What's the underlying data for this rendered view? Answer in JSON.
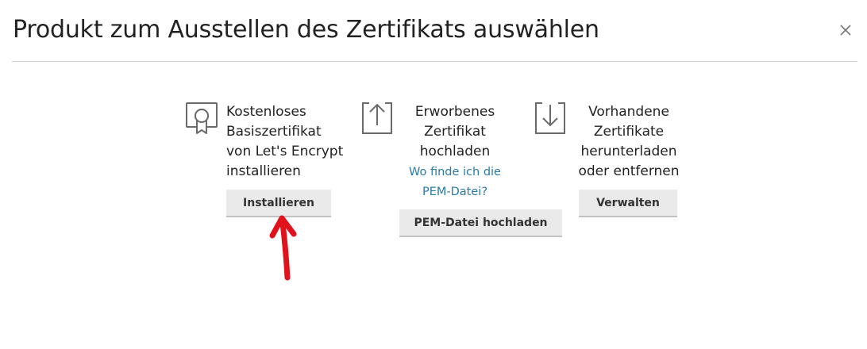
{
  "dialog": {
    "title": "Produkt zum Ausstellen des Zertifikats auswählen",
    "close_icon": "close-icon"
  },
  "options": [
    {
      "icon": "certificate-badge-icon",
      "text": "Kostenloses Basiszertifikat von Let's Encrypt installieren",
      "text_lines": [
        "Kostenloses",
        "Basiszertifikat",
        "von Let's Encrypt",
        "installieren"
      ],
      "button_label": "Installieren"
    },
    {
      "icon": "upload-icon",
      "text_lines": [
        "Erworbenes",
        "Zertifikat",
        "hochladen"
      ],
      "link_lines": [
        "Wo finde ich die",
        "PEM-Datei?"
      ],
      "button_label": "PEM-Datei hochladen"
    },
    {
      "icon": "download-icon",
      "text_lines": [
        "Vorhandene",
        "Zertifikate",
        "herunterladen",
        "oder entfernen"
      ],
      "button_label": "Verwalten"
    }
  ],
  "annotation": {
    "icon": "red-arrow-pointing-up",
    "color": "#e0121b"
  },
  "colors": {
    "link": "#2a7aa8",
    "button_bg": "#eaeaea",
    "icon_stroke": "#6b6b6b"
  }
}
